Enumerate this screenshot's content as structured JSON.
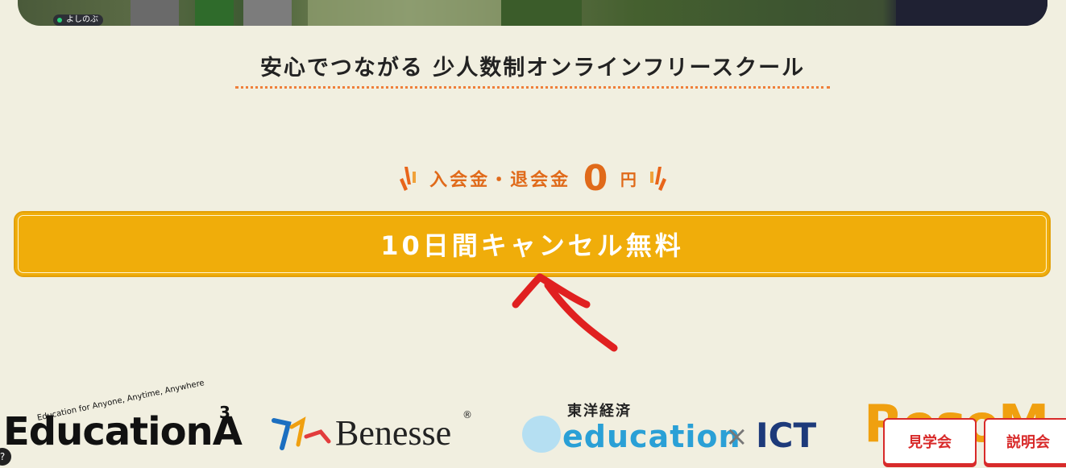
{
  "hero": {
    "user_tag": "よしのぶ"
  },
  "tagline": "安心でつながる 少人数制オンラインフリースクール",
  "fee": {
    "label": "入会金・退会金",
    "amount": "0",
    "unit": "円"
  },
  "cta": {
    "label": "10日間キャンセル無料"
  },
  "logos": {
    "education_a3": {
      "main": "EducationA",
      "sup": "3",
      "arc_text": "Education for Anyone, Anytime, Anywhere"
    },
    "benesse": {
      "word": "Benesse",
      "reg": "®"
    },
    "toyo": {
      "kanji": "東洋経済",
      "edu": "education",
      "x": "×",
      "ict": "ICT"
    },
    "partial": "ResoM"
  },
  "floating_buttons": {
    "tour": "見学会",
    "info": "説明会"
  },
  "corner_badge": "?"
}
